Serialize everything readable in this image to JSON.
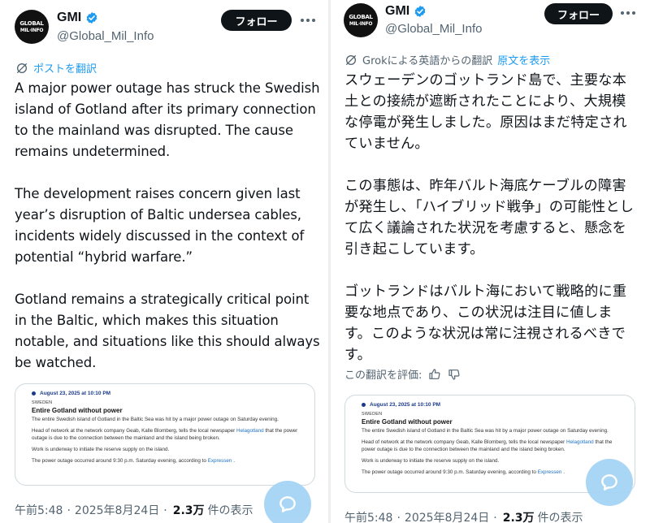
{
  "left": {
    "author": {
      "name": "GMI",
      "handle": "@Global_Mil_Info",
      "avatar_line1": "GLOBAL",
      "avatar_line2": "MIL·INFO"
    },
    "follow_label": "フォロー",
    "translate_label": "ポストを翻訳",
    "body_text": "A major power outage has struck the Swedish island of Gotland after its primary connection to the mainland was disrupted. The cause remains undetermined.\n\nThe development raises concern given last year’s disruption of Baltic undersea cables, incidents widely discussed in the context of potential “hybrid warfare.”\n\nGotland remains a strategically critical point in the Baltic, which makes this situation notable, and situations like this should always be watched.",
    "footer": {
      "time": "午前5:48",
      "date": "2025年8月24日",
      "views_count": "2.3万",
      "views_label": "件の表示"
    }
  },
  "right": {
    "author": {
      "name": "GMI",
      "handle": "@Global_Mil_Info",
      "avatar_line1": "GLOBAL",
      "avatar_line2": "MIL·INFO"
    },
    "follow_label": "フォロー",
    "translated_by": "Grokによる英語からの翻訳",
    "show_original_label": "原文を表示",
    "body_text": "スウェーデンのゴットランド島で、主要な本\n土との接続が遮断されたことにより、大規模\nな停電が発生しました。原因はまだ特定され\nていません。\n\nこの事態は、昨年バルト海底ケーブルの障害\nが発生し、「ハイブリッド戦争」の可能性とし\nて広く議論された状況を考慮すると、懸念を\n引き起こしています。\n\nゴットランドはバルト海において戦略的に重\n要な地点であり、この状況は注目に値しま\nす。このような状況は常に注視されるべきで\nす。",
    "rate_label": "この翻訳を評価:",
    "footer": {
      "time": "午前5:48",
      "date": "2025年8月24日",
      "views_count": "2.3万",
      "views_label": "件の表示"
    }
  },
  "card": {
    "date": "August 23, 2025 at 10:10 PM",
    "section": "SWEDEN",
    "headline": "Entire Gotland without power",
    "p1": "The entire Swedish island of Gotland in the Baltic Sea was hit by a major power outage on Saturday evening.",
    "p2_before": "Head of network at the network company Geab, Kalle Blomberg, tells the local newspaper ",
    "p2_link": "Helagotland",
    "p2_after": " that the power outage is due to the connection between the mainland and the island being broken.",
    "p3": "Work is underway to initiate the reserve supply on the island.",
    "p4_before": "The power outage occurred around 9:30 p.m. Saturday evening, according to ",
    "p4_link": "Expressen",
    "p4_after": " ."
  },
  "colors": {
    "accent": "#1d9bf0",
    "text": "#0f1419",
    "muted": "#536471",
    "follow_bg": "#0f1419",
    "grok_fab": "#a6d4f5"
  },
  "icons": {
    "verified": "verified-badge-icon",
    "translate": "translate-icon",
    "more": "more-icon",
    "thumbs_up": "thumbs-up-icon",
    "thumbs_down": "thumbs-down-icon",
    "grok": "grok-chat-icon"
  }
}
